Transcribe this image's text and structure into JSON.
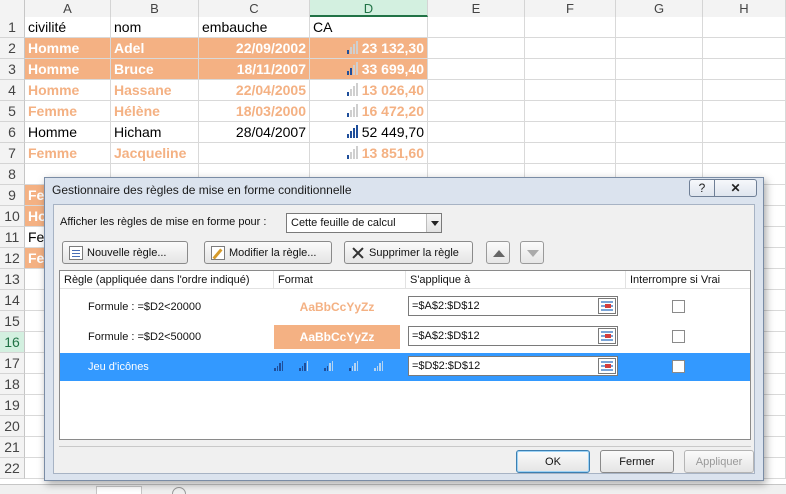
{
  "sheet": {
    "columns": [
      {
        "label": "A",
        "w": 86
      },
      {
        "label": "B",
        "w": 88
      },
      {
        "label": "C",
        "w": 111
      },
      {
        "label": "D",
        "w": 118
      },
      {
        "label": "E",
        "w": 97
      },
      {
        "label": "F",
        "w": 91
      },
      {
        "label": "G",
        "w": 87
      },
      {
        "label": "H",
        "w": 83
      }
    ],
    "selected_column": "D",
    "selected_row": "16",
    "rows": [
      {
        "n": "1",
        "a": "civilité",
        "b": "nom",
        "c": "embauche",
        "d": "CA",
        "style": "plain-left",
        "bars": null
      },
      {
        "n": "2",
        "a": "Homme",
        "b": "Adel",
        "c": "22/09/2002",
        "d": "23 132,30",
        "style": "fill",
        "bars": 1
      },
      {
        "n": "3",
        "a": "Homme",
        "b": "Bruce",
        "c": "18/11/2007",
        "d": "33 699,40",
        "style": "fill",
        "bars": 2
      },
      {
        "n": "4",
        "a": "Homme",
        "b": "Hassane",
        "c": "22/04/2005",
        "d": "13 026,40",
        "style": "orange",
        "bars": 1
      },
      {
        "n": "5",
        "a": "Femme",
        "b": "Hélène",
        "c": "18/03/2000",
        "d": "16 472,20",
        "style": "orange",
        "bars": 1
      },
      {
        "n": "6",
        "a": "Homme",
        "b": "Hicham",
        "c": "28/04/2007",
        "d": "52 449,70",
        "style": "plain",
        "bars": 4
      },
      {
        "n": "7",
        "a": "Femme",
        "b": "Jacqueline",
        "c": "",
        "d": "13 851,60",
        "style": "orange",
        "bars": 1
      },
      {
        "n": "8",
        "a": "",
        "b": "",
        "c": "",
        "d": "",
        "style": "plain",
        "bars": null
      },
      {
        "n": "9",
        "a": "Fe",
        "b": "",
        "c": "",
        "d": "",
        "style": "fillA",
        "bars": null
      },
      {
        "n": "10",
        "a": "Ho",
        "b": "",
        "c": "",
        "d": "",
        "style": "fillA",
        "bars": null
      },
      {
        "n": "11",
        "a": "Fe",
        "b": "",
        "c": "",
        "d": "",
        "style": "plainA",
        "bars": null
      },
      {
        "n": "12",
        "a": "Fe",
        "b": "",
        "c": "",
        "d": "",
        "style": "fillA",
        "bars": null
      },
      {
        "n": "13",
        "a": "",
        "b": "",
        "c": "",
        "d": "",
        "style": "plain",
        "bars": null
      },
      {
        "n": "14",
        "a": "",
        "b": "",
        "c": "",
        "d": "",
        "style": "plain",
        "bars": null
      },
      {
        "n": "15",
        "a": "",
        "b": "",
        "c": "",
        "d": "",
        "style": "plain",
        "bars": null
      },
      {
        "n": "16",
        "a": "",
        "b": "",
        "c": "",
        "d": "",
        "style": "plain",
        "bars": null
      },
      {
        "n": "17",
        "a": "",
        "b": "",
        "c": "",
        "d": "",
        "style": "plain",
        "bars": null
      },
      {
        "n": "18",
        "a": "",
        "b": "",
        "c": "",
        "d": "",
        "style": "plain",
        "bars": null
      },
      {
        "n": "19",
        "a": "",
        "b": "",
        "c": "",
        "d": "",
        "style": "plain",
        "bars": null
      },
      {
        "n": "20",
        "a": "",
        "b": "",
        "c": "",
        "d": "",
        "style": "plain",
        "bars": null
      },
      {
        "n": "21",
        "a": "",
        "b": "",
        "c": "",
        "d": "",
        "style": "plain",
        "bars": null
      },
      {
        "n": "22",
        "a": "",
        "b": "",
        "c": "",
        "d": "",
        "style": "plain",
        "bars": null
      }
    ],
    "colors": {
      "fill": "#f4b183",
      "icon_on": "#1f4e9a",
      "icon_off": "#cfcfcf"
    }
  },
  "dialog": {
    "title": "Gestionnaire des règles de mise en forme conditionnelle",
    "help_label": "?",
    "close_label": "✕",
    "show_rules_label": "Afficher les règles de mise en forme pour :",
    "show_rules_value": "Cette feuille de calcul",
    "new_rule_label": "Nouvelle règle...",
    "edit_rule_label": "Modifier la règle...",
    "delete_rule_label": "Supprimer la règle",
    "columns": {
      "rule": "Règle (appliquée dans l'ordre indiqué)",
      "format": "Format",
      "applies_to": "S'applique à",
      "stop_if_true": "Interrompre si Vrai"
    },
    "rules": [
      {
        "rule": "Formule : =$D2<20000",
        "format_preview": "AaBbCcYyZz",
        "applies_to": "=$A$2:$D$12",
        "selected": false
      },
      {
        "rule": "Formule : =$D2<50000",
        "format_preview": "AaBbCcYyZz",
        "applies_to": "=$A$2:$D$12",
        "selected": false
      },
      {
        "rule": "Jeu d'icônes",
        "format_preview": "",
        "applies_to": "=$D$2:$D$12",
        "selected": true
      }
    ],
    "ok_label": "OK",
    "close_button_label": "Fermer",
    "apply_label": "Appliquer",
    "colors": {
      "selection": "#3399ff"
    }
  }
}
